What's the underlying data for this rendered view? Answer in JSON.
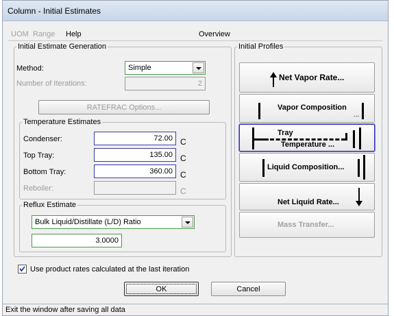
{
  "window": {
    "title": "Column - Initial Estimates"
  },
  "menu": {
    "uom": "UOM",
    "range": "Range",
    "help": "Help",
    "overview": "Overview"
  },
  "generation": {
    "legend": "Initial Estimate Generation",
    "method_label": "Method:",
    "method_value": "Simple",
    "iterations_label": "Number of Iterations:",
    "iterations_value": "2",
    "ratefrac_button": "RATEFRAC Options..."
  },
  "temperature": {
    "legend": "Temperature Estimates",
    "rows": [
      {
        "label": "Condenser:",
        "value": "72.00",
        "unit": "C"
      },
      {
        "label": "Top Tray:",
        "value": "135.00",
        "unit": "C"
      },
      {
        "label": "Bottom Tray:",
        "value": "360.00",
        "unit": "C"
      },
      {
        "label": "Reboiler:",
        "value": "",
        "unit": "C"
      }
    ]
  },
  "reflux": {
    "legend": "Reflux Estimate",
    "type_value": "Bulk Liquid/Distillate (L/D) Ratio",
    "ratio_value": "3.0000"
  },
  "profiles": {
    "legend": "Initial Profiles",
    "net_vapor": "Net Vapor Rate...",
    "vapor_comp": "Vapor Composition",
    "vapor_comp_dots": "...",
    "tray": "Tray",
    "temperature": "Temperature ...",
    "liquid_comp": "Liquid Composition...",
    "net_liquid": "Net Liquid Rate...",
    "mass_transfer": "Mass Transfer..."
  },
  "options": {
    "use_product_rates": "Use product rates calculated at the last iteration",
    "checked": true
  },
  "buttons": {
    "ok": "OK",
    "cancel": "Cancel"
  },
  "status": "Exit the window after saving all data"
}
